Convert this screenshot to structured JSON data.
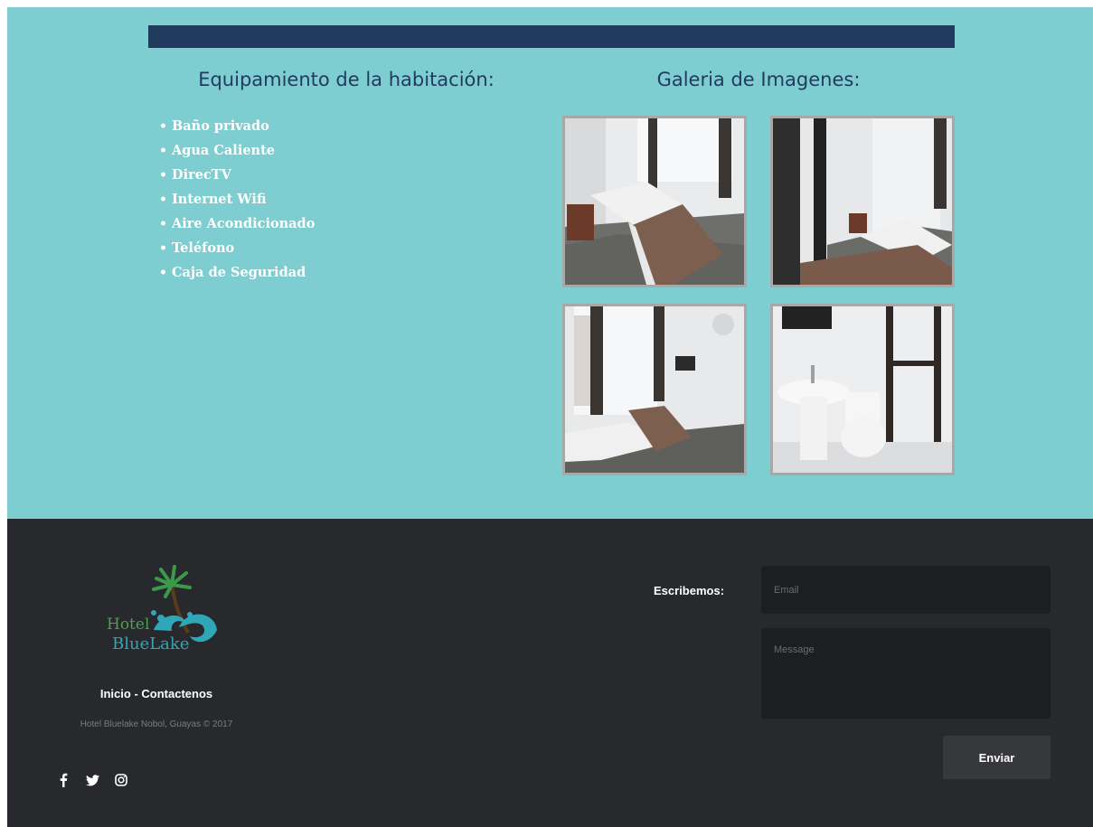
{
  "room": {
    "amenities_title": "Equipamiento de la habitación:",
    "amenities": [
      "Baño privado",
      "Agua Caliente",
      "DirecTV",
      "Internet Wifi",
      "Aire Acondicionado",
      "Teléfono",
      "Caja de Seguridad"
    ],
    "gallery_title": "Galeria de Imagenes:"
  },
  "footer": {
    "logo_line1": "Hotel",
    "logo_line2": "BlueLake",
    "link_home": "Inicio",
    "link_separator": " - ",
    "link_contact": "Contactenos",
    "copyright": "Hotel Bluelake Nobol, Guayas © 2017",
    "social_icons": [
      "facebook-icon",
      "twitter-icon",
      "instagram-icon"
    ],
    "contact_label": "Escribemos:",
    "email_placeholder": "Email",
    "message_placeholder": "Message",
    "send_label": "Enviar"
  },
  "colors": {
    "section_bg": "#7ecdd1",
    "bar": "#1f3c5e",
    "footer_bg": "#27292d",
    "input_bg": "#1d1e21",
    "button_bg": "#36383c"
  }
}
